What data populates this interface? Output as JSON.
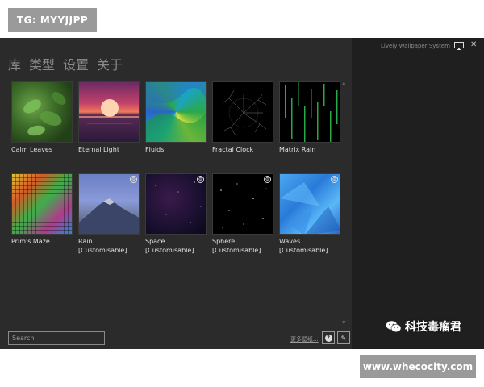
{
  "watermark": {
    "tg": "TG: MYYJJPP",
    "site": "www.whecocity.com",
    "wechat": "科技毒瘤君"
  },
  "nav": {
    "library": "库",
    "types": "类型",
    "settings": "设置",
    "about": "关于"
  },
  "right_pane": {
    "title": "Lively Wallpaper System"
  },
  "wallpapers": [
    {
      "label": "Calm Leaves",
      "customisable": false
    },
    {
      "label": "Eternal Light",
      "customisable": false
    },
    {
      "label": "Fluids",
      "customisable": false
    },
    {
      "label": "Fractal Clock",
      "customisable": false
    },
    {
      "label": "Matrix Rain",
      "customisable": false
    },
    {
      "label": "Prim's Maze",
      "customisable": false
    },
    {
      "label": "Rain [Customisable]",
      "customisable": true
    },
    {
      "label": "Space [Customisable]",
      "customisable": true
    },
    {
      "label": "Sphere [Customisable]",
      "customisable": true
    },
    {
      "label": "Waves [Customisable]",
      "customisable": true
    }
  ],
  "footer": {
    "search_placeholder": "Search",
    "more_link": "更多壁纸...",
    "help_symbol": "?",
    "edit_symbol": "✎"
  },
  "colors": {
    "window_bg": "#2b2b2b",
    "right_pane_bg": "#1f1f1f",
    "accent": "#9a9a9a"
  }
}
